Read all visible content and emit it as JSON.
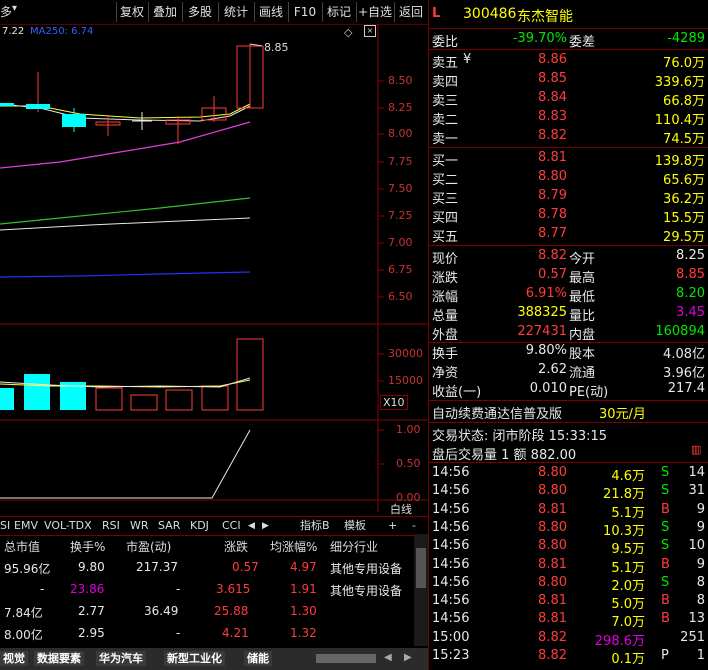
{
  "toolbar": {
    "menu_label": "多",
    "buttons": [
      "复权",
      "叠加",
      "多股",
      "统计",
      "画线",
      "F10",
      "标记",
      "+自选",
      "返回"
    ]
  },
  "chart": {
    "ma_label_1": "7.22",
    "ma_label_2": "MA250: 6.74",
    "price_axis": [
      "8.50",
      "8.25",
      "8.00",
      "7.75",
      "7.50",
      "7.25",
      "7.00",
      "6.75",
      "6.50"
    ],
    "high_label": "8.85",
    "volume_axis": [
      "30000",
      "15000"
    ],
    "volume_unit": "X10",
    "indicator_axis": [
      "1.00",
      "0.50",
      "0.00"
    ],
    "draw_line_label": "白线"
  },
  "indicator_tabs": [
    "SI",
    "EMV",
    "VOL-TDX",
    "RSI",
    "WR",
    "SAR",
    "KDJ",
    "CCI",
    "指标B",
    "模板",
    "+",
    "-"
  ],
  "table": {
    "headers": [
      "总市值",
      "换手%",
      "市盈(动)",
      "涨跌",
      "均涨幅%",
      "细分行业"
    ],
    "rows": [
      [
        "95.96亿",
        "9.80",
        "217.37",
        "0.57",
        "4.97",
        "其他专用设备"
      ],
      [
        "-",
        "23.86",
        "-",
        "3.615",
        "1.91",
        "其他专用设备"
      ],
      [
        "7.84亿",
        "2.77",
        "36.49",
        "25.88",
        "1.30",
        ""
      ],
      [
        "8.00亿",
        "2.95",
        "-",
        "4.21",
        "1.32",
        ""
      ]
    ]
  },
  "sheet_tabs": [
    "视觉",
    "数据要素",
    "华为汽车",
    "新型工业化",
    "储能"
  ],
  "right": {
    "flag": "L",
    "code": "300486",
    "name": "东杰智能",
    "webi_label": "委比",
    "webi_value": "-39.70%",
    "weicha_label": "委差",
    "weicha_value": "-4289",
    "sell": [
      {
        "label": "卖五",
        "mark": "¥",
        "price": "8.86",
        "vol": "76.0万"
      },
      {
        "label": "卖四",
        "mark": "",
        "price": "8.85",
        "vol": "339.6万"
      },
      {
        "label": "卖三",
        "mark": "",
        "price": "8.84",
        "vol": "66.8万"
      },
      {
        "label": "卖二",
        "mark": "",
        "price": "8.83",
        "vol": "110.4万"
      },
      {
        "label": "卖一",
        "mark": "",
        "price": "8.82",
        "vol": "74.5万"
      }
    ],
    "buy": [
      {
        "label": "买一",
        "price": "8.81",
        "vol": "139.8万"
      },
      {
        "label": "买二",
        "price": "8.80",
        "vol": "65.6万"
      },
      {
        "label": "买三",
        "price": "8.79",
        "vol": "36.2万"
      },
      {
        "label": "买四",
        "price": "8.78",
        "vol": "15.5万"
      },
      {
        "label": "买五",
        "price": "8.77",
        "vol": "29.5万"
      }
    ],
    "quote": [
      {
        "l1": "现价",
        "v1": "8.82",
        "l2": "今开",
        "v2": "8.25"
      },
      {
        "l1": "涨跌",
        "v1": "0.57",
        "l2": "最高",
        "v2": "8.85"
      },
      {
        "l1": "涨幅",
        "v1": "6.91%",
        "l2": "最低",
        "v2": "8.20"
      },
      {
        "l1": "总量",
        "v1": "388325",
        "l2": "量比",
        "v2": "3.45"
      },
      {
        "l1": "外盘",
        "v1": "227431",
        "l2": "内盘",
        "v2": "160894"
      }
    ],
    "fin": [
      {
        "l1": "换手",
        "v1": "9.80%",
        "l2": "股本",
        "v2": "4.08亿"
      },
      {
        "l1": "净资",
        "v1": "2.62",
        "l2": "流通",
        "v2": "3.96亿"
      },
      {
        "l1": "收益(一)",
        "v1": "0.010",
        "l2": "PE(动)",
        "v2": "217.4"
      }
    ],
    "ad_text": "自动续费通达信普及版",
    "ad_price": "30元/月",
    "status_line": "交易状态: 闭市阶段 15:33:15",
    "after_hours": "盘后交易量 1 额 882.00",
    "ticks": [
      {
        "t": "14:56",
        "p": "8.80",
        "v": "4.6万",
        "s": "S",
        "n": "14"
      },
      {
        "t": "14:56",
        "p": "8.80",
        "v": "21.8万",
        "s": "S",
        "n": "31"
      },
      {
        "t": "14:56",
        "p": "8.81",
        "v": "5.1万",
        "s": "B",
        "n": "9"
      },
      {
        "t": "14:56",
        "p": "8.80",
        "v": "10.3万",
        "s": "S",
        "n": "9"
      },
      {
        "t": "14:56",
        "p": "8.80",
        "v": "9.5万",
        "s": "S",
        "n": "10"
      },
      {
        "t": "14:56",
        "p": "8.81",
        "v": "5.1万",
        "s": "B",
        "n": "9"
      },
      {
        "t": "14:56",
        "p": "8.80",
        "v": "2.0万",
        "s": "S",
        "n": "8"
      },
      {
        "t": "14:56",
        "p": "8.81",
        "v": "5.0万",
        "s": "B",
        "n": "8"
      },
      {
        "t": "14:56",
        "p": "8.81",
        "v": "7.0万",
        "s": "B",
        "n": "13"
      },
      {
        "t": "15:00",
        "p": "8.82",
        "v": "298.6万",
        "s": "",
        "n": "251"
      },
      {
        "t": "15:23",
        "p": "8.82",
        "v": "0.1万",
        "s": "P",
        "n": "1"
      }
    ]
  }
}
